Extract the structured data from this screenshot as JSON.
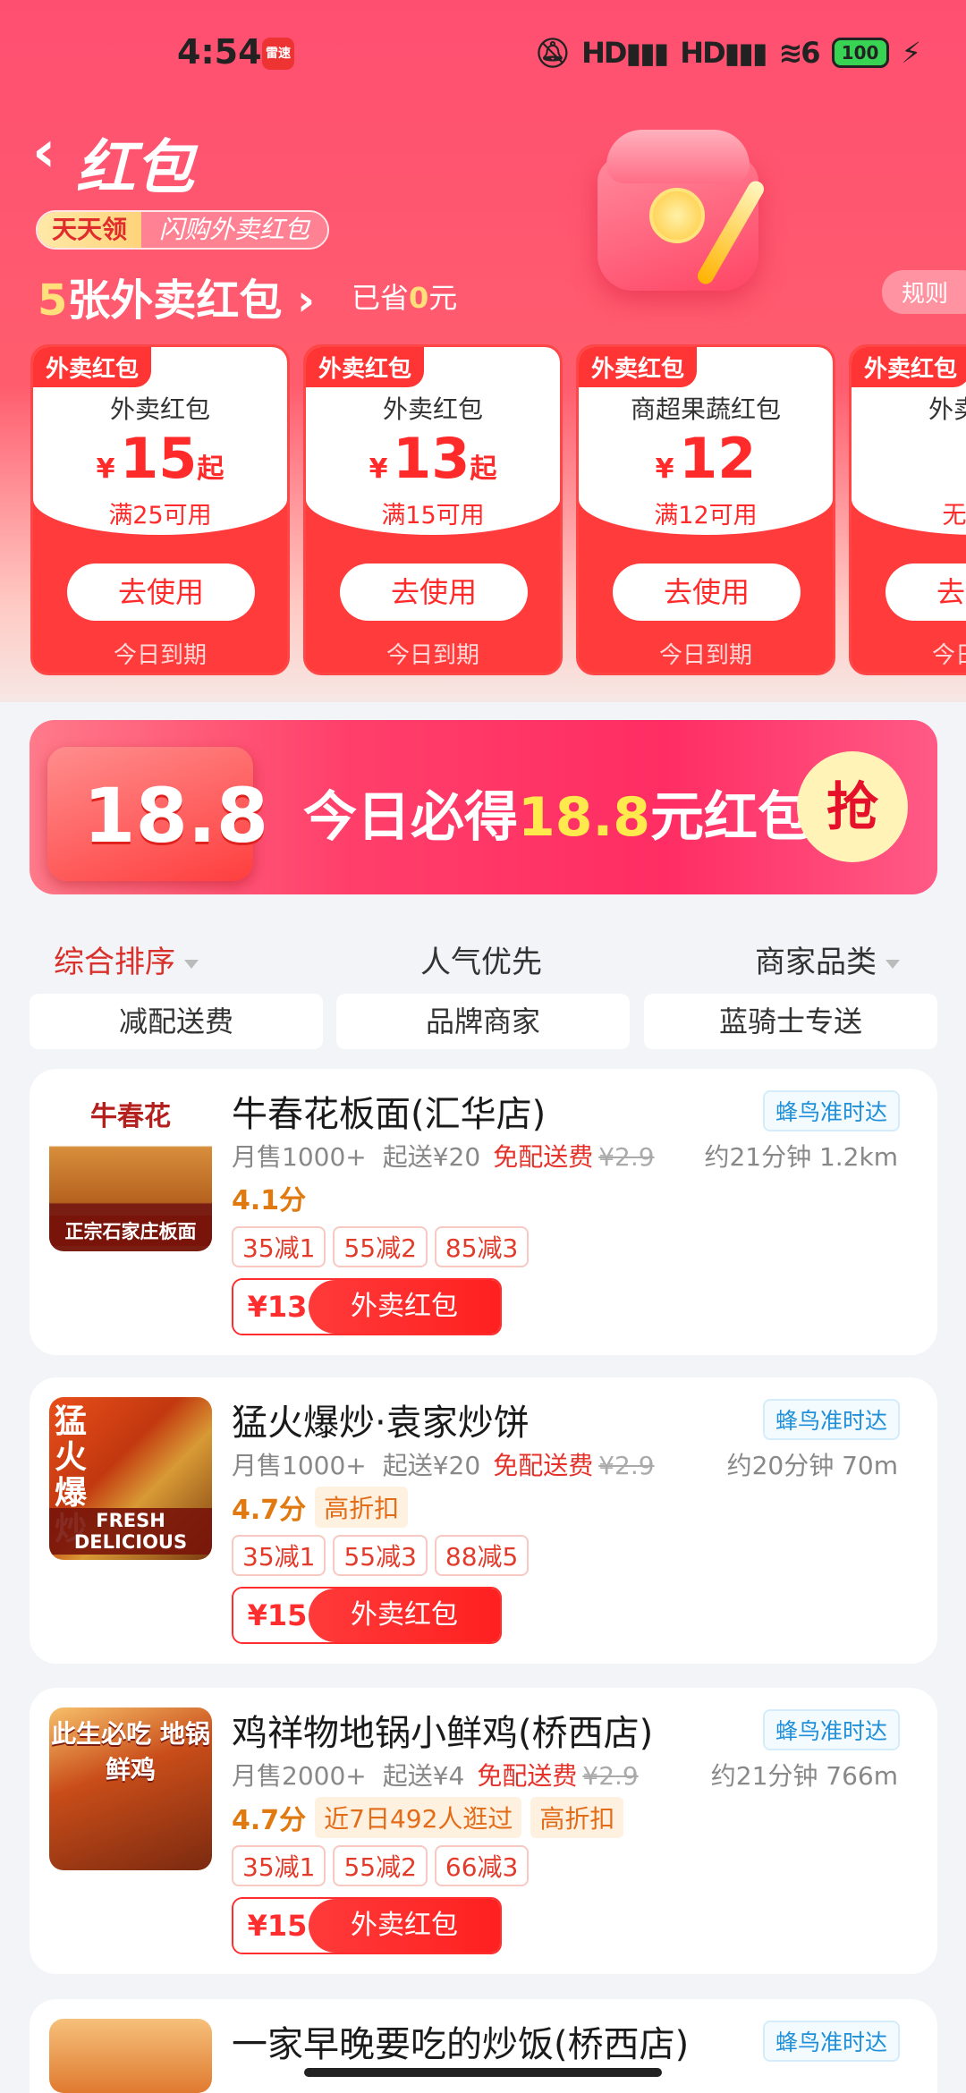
{
  "status_bar": {
    "time": "4:54",
    "app_badge": "雷速",
    "signal1": "HD▮▮▮",
    "signal2": "HD▮▮▮",
    "wifi": "≋6",
    "battery": "100",
    "charging": "⚡"
  },
  "header": {
    "back_glyph": "‹",
    "title": "红包",
    "tag_left": "天天领",
    "tag_right": "闪购外卖红包",
    "count_num": "5",
    "count_text": "张外卖红包 ›",
    "saved_prefix": "已省",
    "saved_num": "0",
    "saved_suffix": "元",
    "rules": "规则"
  },
  "coupons": [
    {
      "corner": "外卖红包",
      "name": "外卖红包",
      "yen": "¥",
      "amount": "15",
      "suffix": "起",
      "condition": "满25可用",
      "button": "去使用",
      "expire": "今日到期"
    },
    {
      "corner": "外卖红包",
      "name": "外卖红包",
      "yen": "¥",
      "amount": "13",
      "suffix": "起",
      "condition": "满15可用",
      "button": "去使用",
      "expire": "今日到期"
    },
    {
      "corner": "外卖红包",
      "name": "商超果蔬红包",
      "yen": "¥",
      "amount": "12",
      "suffix": "",
      "condition": "满12可用",
      "button": "去使用",
      "expire": "今日到期"
    },
    {
      "corner": "外卖红包",
      "name": "外卖红包",
      "yen": "¥",
      "amount": "",
      "suffix": "",
      "condition": "无门槛",
      "button": "去使用",
      "expire": "今日到期"
    }
  ],
  "banner": {
    "bag_value": "18.8",
    "text_prefix": "今日必得",
    "text_amount": "18.8",
    "text_suffix": "元红包",
    "grab": "抢"
  },
  "sort": {
    "item1": "综合排序",
    "item2": "人气优先",
    "item3": "商家品类"
  },
  "filters": [
    "减配送费",
    "品牌商家",
    "蓝骑士专送"
  ],
  "shops": [
    {
      "name": "牛春花板面(汇华店)",
      "badge": "蜂鸟准时达",
      "sales": "月售1000+",
      "min": "起送¥20",
      "free": "免配送费",
      "orig_fee": "¥2.9",
      "distance": "约21分钟 1.2km",
      "score": "4.1分",
      "chips": [],
      "discounts": [
        "35减1",
        "55减2",
        "85减3"
      ],
      "redpack_amount": "¥13",
      "redpack_label": "外卖红包",
      "thumb_top": "牛春花",
      "thumb_bottom": "正宗石家庄板面"
    },
    {
      "name": "猛火爆炒·袁家炒饼",
      "badge": "蜂鸟准时达",
      "sales": "月售1000+",
      "min": "起送¥20",
      "free": "免配送费",
      "orig_fee": "¥2.9",
      "distance": "约20分钟 70m",
      "score": "4.7分",
      "chips": [
        "高折扣"
      ],
      "discounts": [
        "35减1",
        "55减3",
        "88减5"
      ],
      "redpack_amount": "¥15",
      "redpack_label": "外卖红包",
      "thumb_top": "猛火爆炒",
      "thumb_bottom": "FRESH DELICIOUS"
    },
    {
      "name": "鸡祥物地锅小鲜鸡(桥西店)",
      "badge": "蜂鸟准时达",
      "sales": "月售2000+",
      "min": "起送¥4",
      "free": "免配送费",
      "orig_fee": "¥2.9",
      "distance": "约21分钟 766m",
      "score": "4.7分",
      "chips": [
        "近7日492人逛过",
        "高折扣"
      ],
      "discounts": [
        "35减1",
        "55减2",
        "66减3"
      ],
      "redpack_amount": "¥15",
      "redpack_label": "外卖红包",
      "thumb_top": "此生必吃 地锅鲜鸡",
      "thumb_bottom": ""
    },
    {
      "name": "一家早晚要吃的炒饭(桥西店)",
      "badge": "蜂鸟准时达"
    }
  ]
}
